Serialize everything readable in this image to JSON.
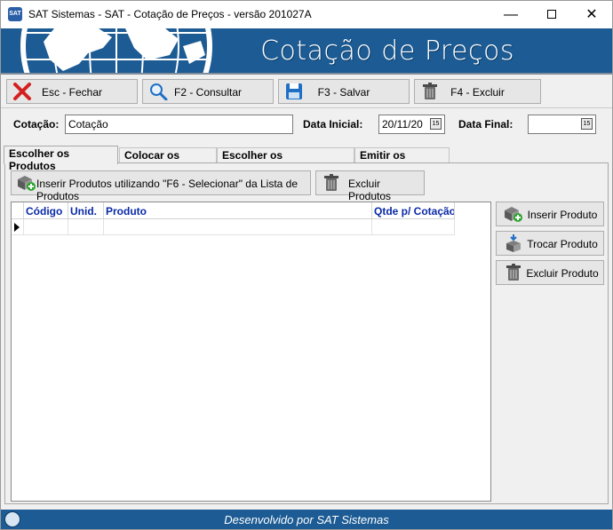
{
  "window": {
    "title": "SAT Sistemas - SAT - Cotação de Preços - versão 201027A",
    "app_icon_text": "SAT",
    "minimize_glyph": "—",
    "close_glyph": "✕"
  },
  "banner": {
    "title": "Cotação de Preços"
  },
  "toolbar": {
    "close_label": "Esc - Fechar",
    "consult_label": "F2 - Consultar",
    "save_label": "F3 - Salvar",
    "delete_label": "F4 - Excluir"
  },
  "form": {
    "cotacao_label": "Cotação:",
    "cotacao_value": "Cotação",
    "data_inicial_label": "Data Inicial:",
    "data_inicial_value": "20/11/20",
    "data_final_label": "Data Final:",
    "data_final_value": "",
    "calendar_glyph": "15"
  },
  "tabs": [
    {
      "label": "Escolher os Produtos",
      "active": true
    },
    {
      "label": "Colocar os Preços",
      "active": false
    },
    {
      "label": "Escolher os Fornecedores",
      "active": false
    },
    {
      "label": "Emitir os Pedidos",
      "active": false
    }
  ],
  "panel": {
    "insert_from_list_label": "Inserir Produtos utilizando  \"F6 - Selecionar\" da Lista de Produtos",
    "delete_products_label": "Excluir Produtos"
  },
  "grid": {
    "columns": [
      "Código",
      "Unid.",
      "Produto",
      "Qtde p/ Cotação"
    ],
    "rows": [
      [
        "",
        "",
        "",
        ""
      ]
    ]
  },
  "side_buttons": {
    "insert_label": "Inserir Produto",
    "swap_label": "Trocar Produto",
    "delete_label": "Excluir Produto"
  },
  "status": {
    "text": "Desenvolvido por SAT Sistemas"
  },
  "colors": {
    "banner_blue": "#1c5b93",
    "header_text_blue": "#0b2aa8",
    "close_red": "#d42020",
    "add_green": "#2fa52f"
  }
}
